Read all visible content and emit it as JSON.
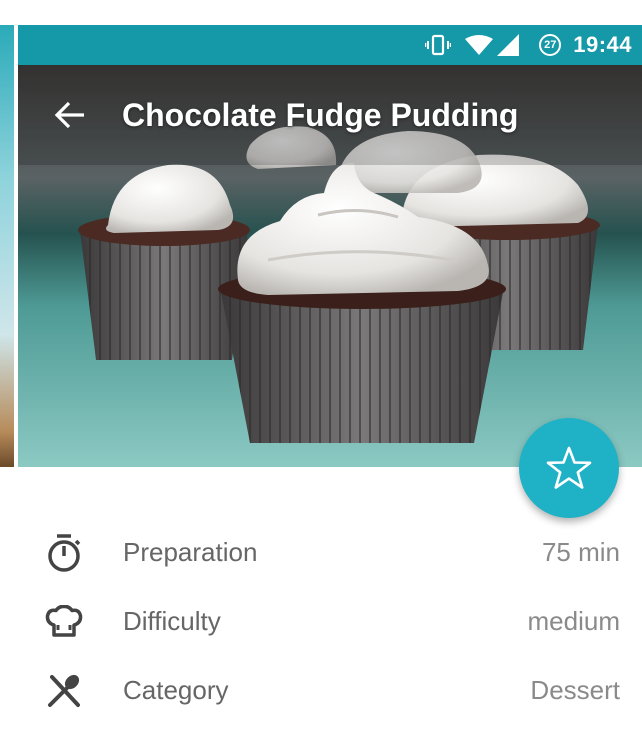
{
  "status_bar": {
    "time": "19:44",
    "notification_count": "27",
    "icons": [
      "vibrate-icon",
      "wifi-icon",
      "signal-icon",
      "notification-badge-icon"
    ],
    "color": "#1598a7"
  },
  "toolbar": {
    "title": "Chocolate Fudge Pudding",
    "back_icon": "back-arrow-icon"
  },
  "hero": {
    "image": "cupcakes-photo"
  },
  "fab": {
    "icon": "star-outline-icon",
    "color": "#1fb2c6"
  },
  "details": [
    {
      "icon": "timer-icon",
      "label": "Preparation",
      "value": "75 min"
    },
    {
      "icon": "chef-hat-icon",
      "label": "Difficulty",
      "value": "medium"
    },
    {
      "icon": "utensils-crossed-icon",
      "label": "Category",
      "value": "Dessert"
    }
  ]
}
